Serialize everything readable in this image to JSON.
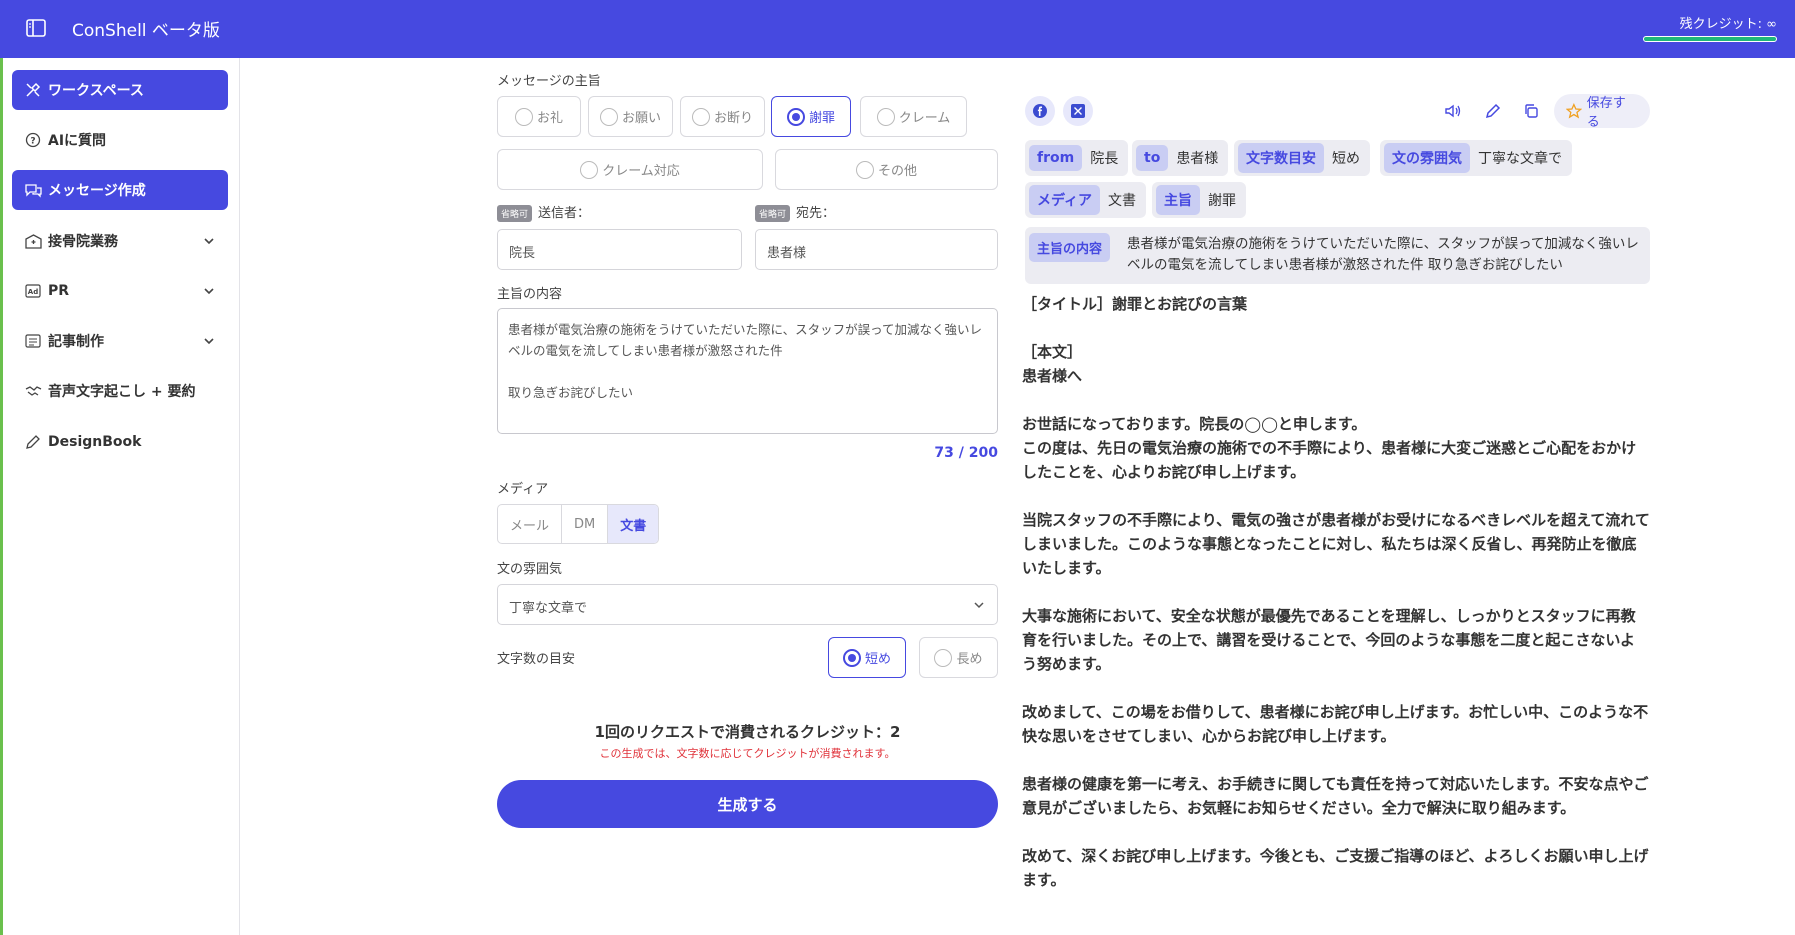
{
  "header": {
    "title": "ConShell ベータ版",
    "credit_label": "残クレジット: ∞",
    "brand_color": "#4649e0"
  },
  "sidebar": {
    "items": [
      {
        "label": "ワークスペース",
        "icon": "tools-icon",
        "active": true
      },
      {
        "label": "AIに質問",
        "icon": "question-bubble-icon",
        "active": false
      },
      {
        "label": "メッセージ作成",
        "icon": "chat-bubbles-icon",
        "active": true
      },
      {
        "label": "接骨院業務",
        "icon": "clinic-icon",
        "active": false,
        "expandable": true
      },
      {
        "label": "PR",
        "icon": "ad-icon",
        "active": false,
        "expandable": true
      },
      {
        "label": "記事制作",
        "icon": "newspaper-icon",
        "active": false,
        "expandable": true
      },
      {
        "label": "音声文字起こし + 要約",
        "icon": "handshake-icon",
        "active": false
      },
      {
        "label": "DesignBook",
        "icon": "pen-icon",
        "active": false
      }
    ]
  },
  "form": {
    "purpose_label": "メッセージの主旨",
    "purpose_options": [
      "お礼",
      "お願い",
      "お断り",
      "謝罪",
      "クレーム",
      "クレーム対応",
      "その他"
    ],
    "purpose_selected": "謝罪",
    "optional_tag": "省略可",
    "sender_label": "送信者：",
    "sender_value": "院長",
    "recipient_label": "宛先：",
    "recipient_value": "患者様",
    "content_label": "主旨の内容",
    "content_value": "患者様が電気治療の施術をうけていただいた際に、スタッフが誤って加減なく強いレベルの電気を流してしまい患者様が激怒された件\n\n取り急ぎお詫びしたい",
    "char_count": "73 / 200",
    "media_label": "メディア",
    "media_options": [
      "メール",
      "DM",
      "文書"
    ],
    "media_selected": "文書",
    "tone_label": "文の雰囲気",
    "tone_value": "丁寧な文章で",
    "length_label": "文字数の目安",
    "length_options": [
      "短め",
      "長め"
    ],
    "length_selected": "短め",
    "cost_text": "1回のリクエストで消費されるクレジット：2",
    "cost_note": "この生成では、文字数に応じてクレジットが消費されます。",
    "generate_label": "生成する"
  },
  "result": {
    "save_label": "保存する",
    "chips": [
      {
        "key": "from",
        "value": "院長"
      },
      {
        "key": "to",
        "value": "患者様"
      },
      {
        "key": "文字数目安",
        "value": "短め"
      },
      {
        "key": "文の雰囲気",
        "value": "丁寧な文章で"
      },
      {
        "key": "メディア",
        "value": "文書"
      },
      {
        "key": "主旨",
        "value": "謝罪"
      }
    ],
    "content_key": "主旨の内容",
    "content_value": "患者様が電気治療の施術をうけていただいた際に、スタッフが誤って加減なく強いレベルの電気を流してしまい患者様が激怒された件 取り急ぎお詫びしたい",
    "lines": [
      "［タイトル］謝罪とお詫びの言葉",
      "",
      "［本文］",
      "患者様へ",
      "",
      "お世話になっております。院長の◯◯と申します。",
      "この度は、先日の電気治療の施術での不手際により、患者様に大変ご迷惑とご心配をおかけしたことを、心よりお詫び申し上げます。",
      "",
      "当院スタッフの不手際により、電気の強さが患者様がお受けになるべきレベルを超えて流れてしまいました。このような事態となったことに対し、私たちは深く反省し、再発防止を徹底いたします。",
      "",
      "大事な施術において、安全な状態が最優先であることを理解し、しっかりとスタッフに再教育を行いました。その上で、講習を受けることで、今回のような事態を二度と起こさないよう努めます。",
      "",
      "改めまして、この場をお借りして、患者様にお詫び申し上げます。お忙しい中、このような不快な思いをさせてしまい、心からお詫び申し上げます。",
      "",
      "患者様の健康を第一に考え、お手続きに関しても責任を持って対応いたします。不安な点やご意見がございましたら、お気軽にお知らせください。全力で解決に取り組みます。",
      "",
      "改めて、深くお詫び申し上げます。今後とも、ご支援ご指導のほど、よろしくお願い申し上げます。"
    ]
  }
}
